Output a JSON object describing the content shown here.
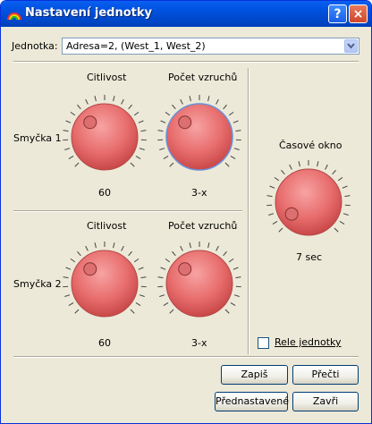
{
  "window": {
    "title": "Nastavení jednotky",
    "help_label": "?",
    "close_label": "×"
  },
  "unit": {
    "label": "Jednotka:",
    "value": "Adresa=2, (West_1, West_2)"
  },
  "loop1": {
    "label": "Smyčka 1",
    "sensitivity": {
      "header": "Citlivost",
      "value": "60"
    },
    "triggers": {
      "header": "Počet vzruchů",
      "value": "3-x"
    }
  },
  "loop2": {
    "label": "Smyčka 2",
    "sensitivity": {
      "header": "Citlivost",
      "value": "60"
    },
    "triggers": {
      "header": "Počet vzruchů",
      "value": "3-x"
    }
  },
  "time_window": {
    "header": "Časové okno",
    "value": "7 sec"
  },
  "relay": {
    "label": "Rele jednotky",
    "checked": false
  },
  "buttons": {
    "write": "Zapiš",
    "read": "Přečti",
    "preset": "Přednastavené",
    "close": "Zavři"
  },
  "colors": {
    "titlebar": "#0054e3",
    "dialog_bg": "#ece9d8",
    "knob": "#e66a6a",
    "focus_ring": "#6b8fd6"
  }
}
